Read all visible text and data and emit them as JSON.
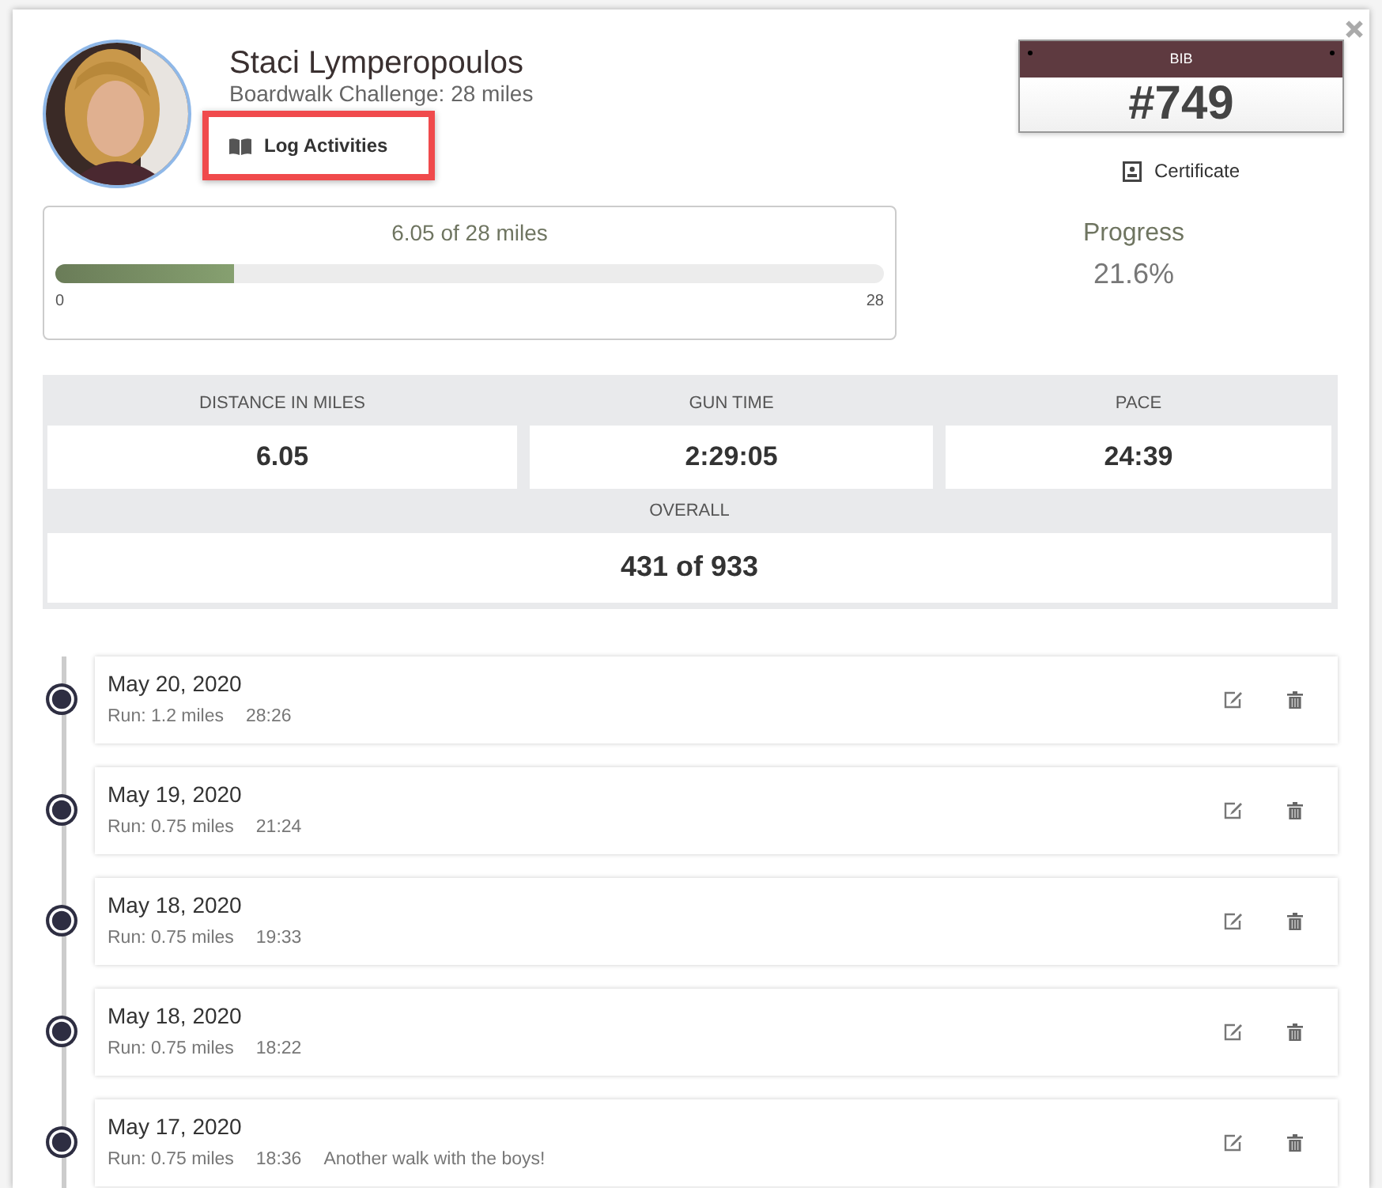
{
  "profile": {
    "name": "Staci Lymperopoulos",
    "challenge": "Boardwalk Challenge: 28 miles",
    "log_button": "Log Activities",
    "highlighted": true
  },
  "bib": {
    "label": "BIB",
    "number": "#749",
    "certificate": "Certificate"
  },
  "progress": {
    "summary": "6.05 of 28 miles",
    "level": 0.216,
    "min": "0",
    "max": "28",
    "title": "Progress",
    "percent": "21.6%"
  },
  "stats": [
    {
      "label": "DISTANCE IN MILES",
      "value": "6.05"
    },
    {
      "label": "GUN TIME",
      "value": "2:29:05"
    },
    {
      "label": "PACE",
      "value": "24:39"
    }
  ],
  "overall": {
    "label": "OVERALL",
    "value": "431 of 933"
  },
  "activities": [
    {
      "date": "May 20, 2020",
      "distance": "Run: 1.2 miles",
      "time": "28:26"
    },
    {
      "date": "May 19, 2020",
      "distance": "Run: 0.75 miles",
      "time": "21:24"
    },
    {
      "date": "May 18, 2020",
      "distance": "Run: 0.75 miles",
      "time": "19:33"
    },
    {
      "date": "May 18, 2020",
      "distance": "Run: 0.75 miles",
      "time": "18:22"
    },
    {
      "date": "May 17, 2020",
      "distance": "Run: 0.75 miles",
      "time": "18:36",
      "note": "Another walk with the boys!"
    }
  ]
}
